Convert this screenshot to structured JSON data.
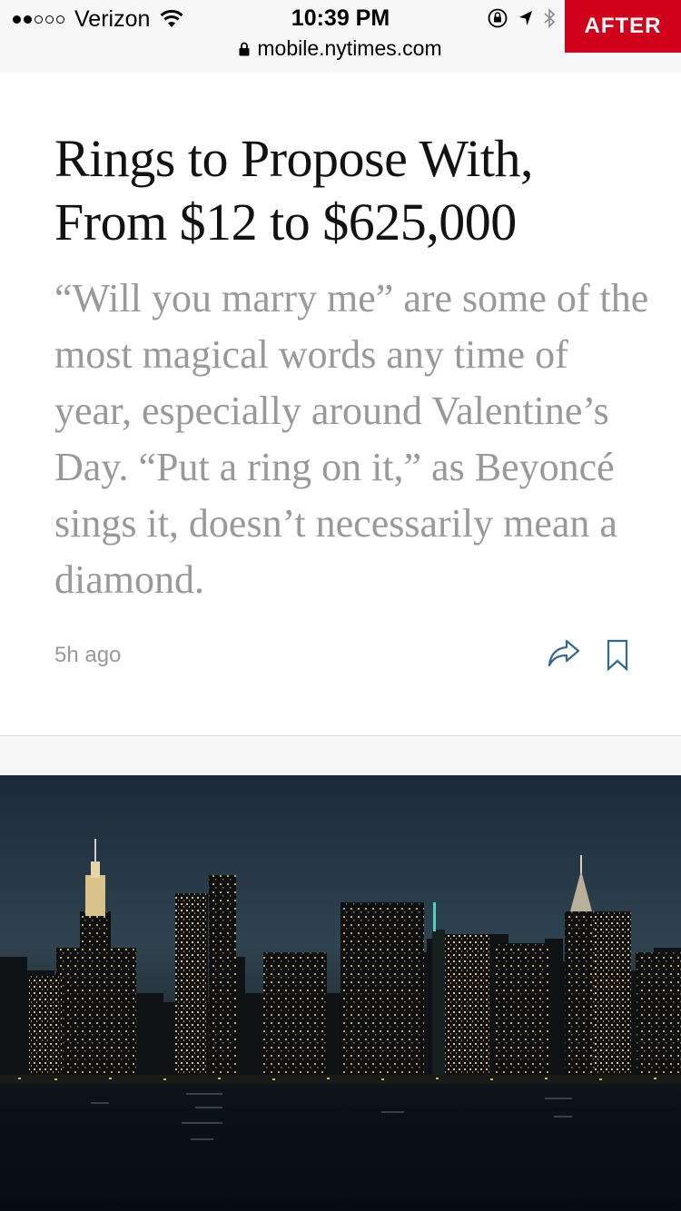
{
  "status_bar": {
    "carrier": "Verizon",
    "time": "10:39 PM",
    "url": "mobile.nytimes.com",
    "signal_bars_filled": 2,
    "signal_bars_total": 5
  },
  "badge": {
    "label": "AFTER",
    "color": "#d0021b"
  },
  "article": {
    "headline": "Rings to Propose With, From $12 to $625,000",
    "summary": "“Will you marry me” are some of the most magical words any time of year, especially around Valentine’s Day. “Put a ring on it,” as Beyoncé sings it, doesn’t necessarily mean a diamond.",
    "timestamp": "5h ago",
    "share_icon": "share-icon",
    "save_icon": "bookmark-icon",
    "accent_color": "#326891"
  }
}
